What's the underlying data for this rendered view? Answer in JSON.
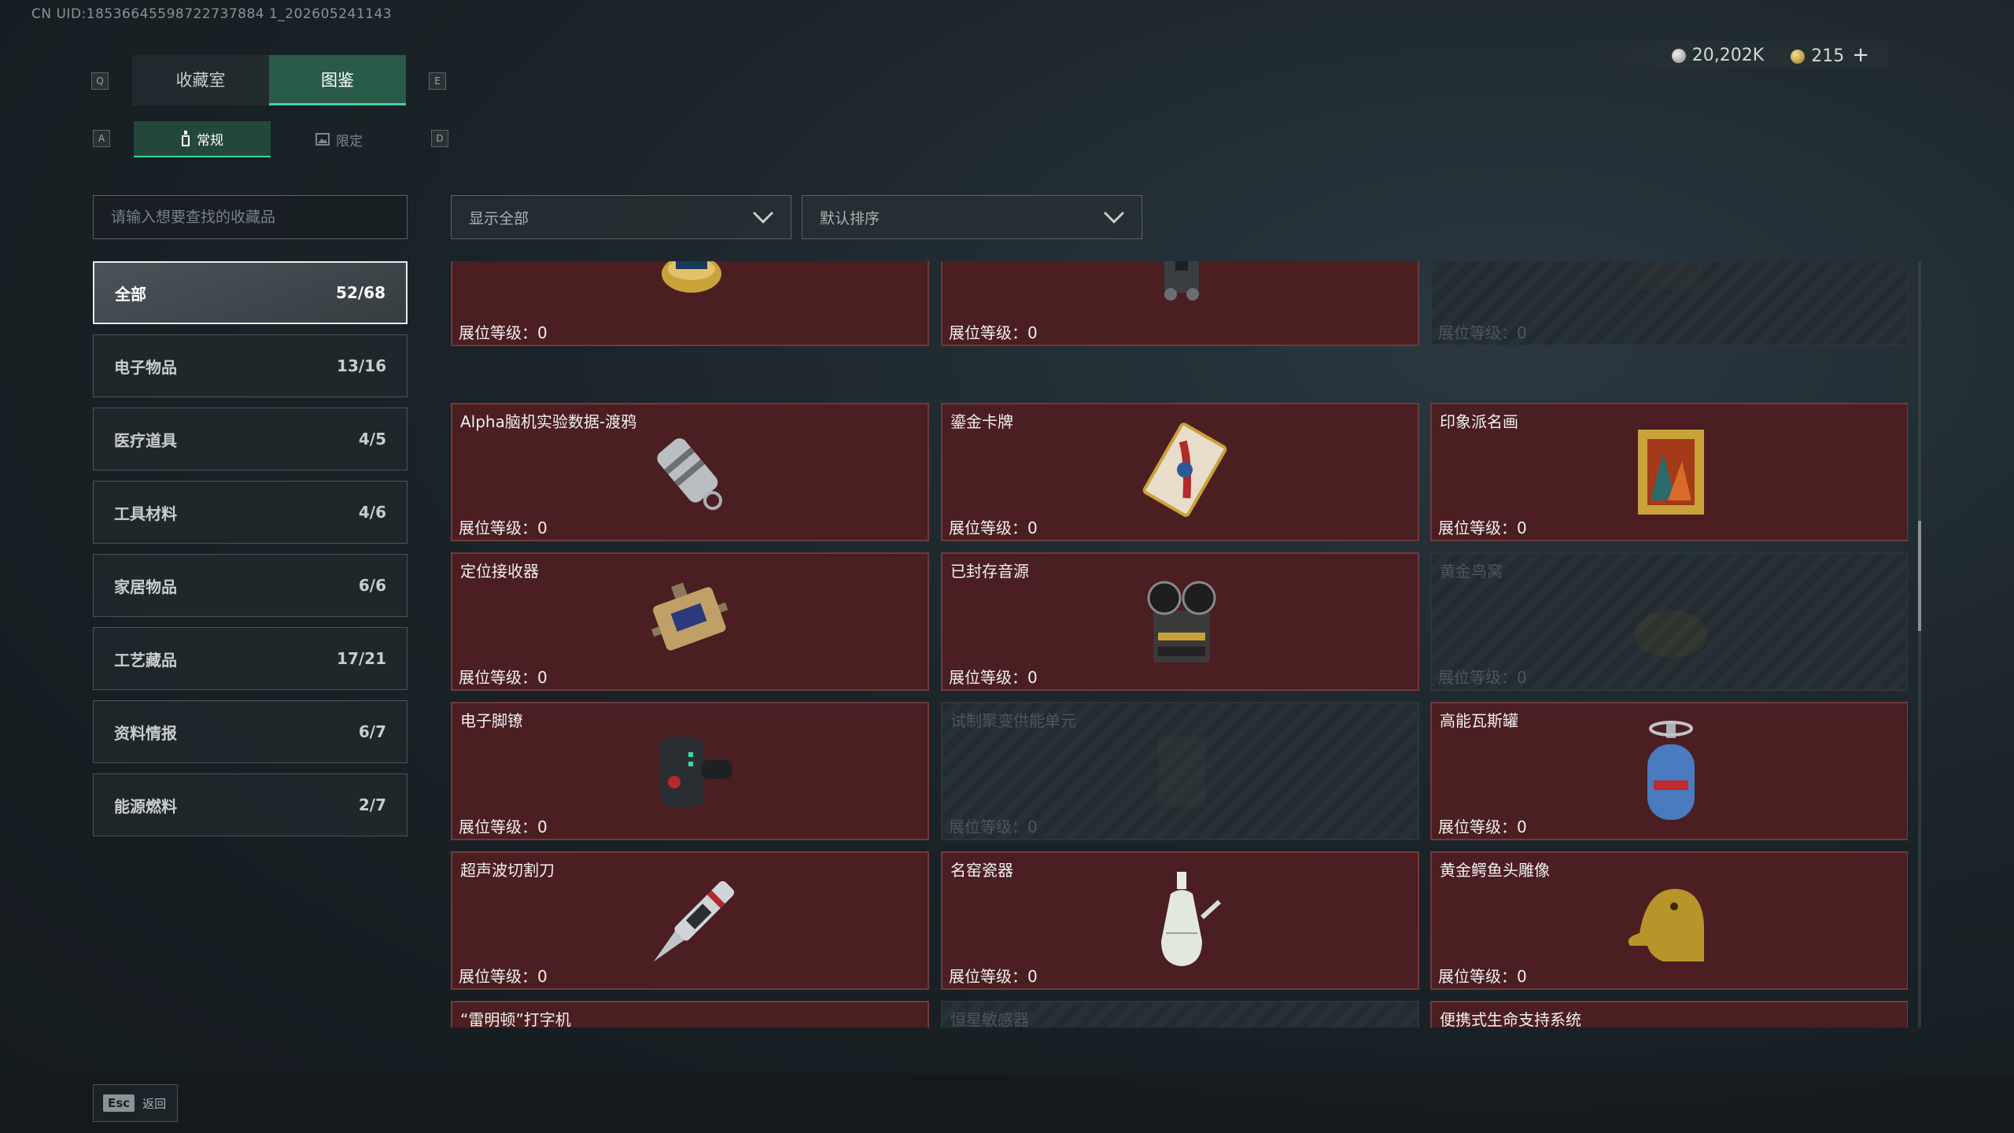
{
  "uid": "CN UID:18536645598722737884 1_202605241143",
  "header": {
    "key_q": "Q",
    "key_e": "E",
    "key_a": "A",
    "key_d": "D",
    "tabs": [
      {
        "label": "收藏室"
      },
      {
        "label": "图鉴"
      }
    ],
    "subtabs": [
      {
        "label": "常规",
        "icon": "bottle-icon"
      },
      {
        "label": "限定",
        "icon": "image-icon"
      }
    ]
  },
  "currency": {
    "silver": "20,202K",
    "gold": "215",
    "plus": "+"
  },
  "search": {
    "placeholder": "请输入想要查找的收藏品"
  },
  "filters": {
    "show": "显示全部",
    "sort": "默认排序"
  },
  "categories": [
    {
      "label": "全部",
      "count": "52/68"
    },
    {
      "label": "电子物品",
      "count": "13/16"
    },
    {
      "label": "医疗道具",
      "count": "4/5"
    },
    {
      "label": "工具材料",
      "count": "4/6"
    },
    {
      "label": "家居物品",
      "count": "6/6"
    },
    {
      "label": "工艺藏品",
      "count": "17/21"
    },
    {
      "label": "资料情报",
      "count": "6/7"
    },
    {
      "label": "能源燃料",
      "count": "2/7"
    }
  ],
  "items": [
    {
      "name": "",
      "level": "展位等级：0",
      "icon": "caviar-tin-icon",
      "locked": false
    },
    {
      "name": "",
      "level": "展位等级：0",
      "icon": "field-radio-icon",
      "locked": false
    },
    {
      "name": "",
      "level": "展位等级：0",
      "icon": "unknown-item-icon",
      "locked": true
    },
    {
      "name": "Alpha脑机实验数据-渡鸦",
      "level": "展位等级：0",
      "icon": "data-capsule-icon",
      "locked": false
    },
    {
      "name": "鎏金卡牌",
      "level": "展位等级：0",
      "icon": "gilded-card-icon",
      "locked": false
    },
    {
      "name": "印象派名画",
      "level": "展位等级：0",
      "icon": "painting-icon",
      "locked": false
    },
    {
      "name": "定位接收器",
      "level": "展位等级：0",
      "icon": "locator-receiver-icon",
      "locked": false
    },
    {
      "name": "已封存音源",
      "level": "展位等级：0",
      "icon": "reel-recorder-icon",
      "locked": false
    },
    {
      "name": "黄金鸟窝",
      "level": "展位等级：0",
      "icon": "golden-nest-icon",
      "locked": true
    },
    {
      "name": "电子脚镣",
      "level": "展位等级：0",
      "icon": "ankle-monitor-icon",
      "locked": false
    },
    {
      "name": "试制聚变供能单元",
      "level": "展位等级：0",
      "icon": "fusion-cell-icon",
      "locked": true
    },
    {
      "name": "高能瓦斯罐",
      "level": "展位等级：0",
      "icon": "gas-canister-icon",
      "locked": false
    },
    {
      "name": "超声波切割刀",
      "level": "展位等级：0",
      "icon": "ultrasonic-knife-icon",
      "locked": false
    },
    {
      "name": "名窑瓷器",
      "level": "展位等级：0",
      "icon": "porcelain-vase-icon",
      "locked": false
    },
    {
      "name": "黄金鳄鱼头雕像",
      "level": "展位等级：0",
      "icon": "crocodile-statue-icon",
      "locked": false
    },
    {
      "name": "“雷明顿”打字机",
      "level": "",
      "icon": "typewriter-icon",
      "locked": false
    },
    {
      "name": "恒星敏感器",
      "level": "",
      "icon": "star-sensor-icon",
      "locked": true
    },
    {
      "name": "便携式生命支持系统",
      "level": "",
      "icon": "life-support-icon",
      "locked": false
    }
  ],
  "footer": {
    "esc_key": "Esc",
    "esc_label": "返回"
  }
}
